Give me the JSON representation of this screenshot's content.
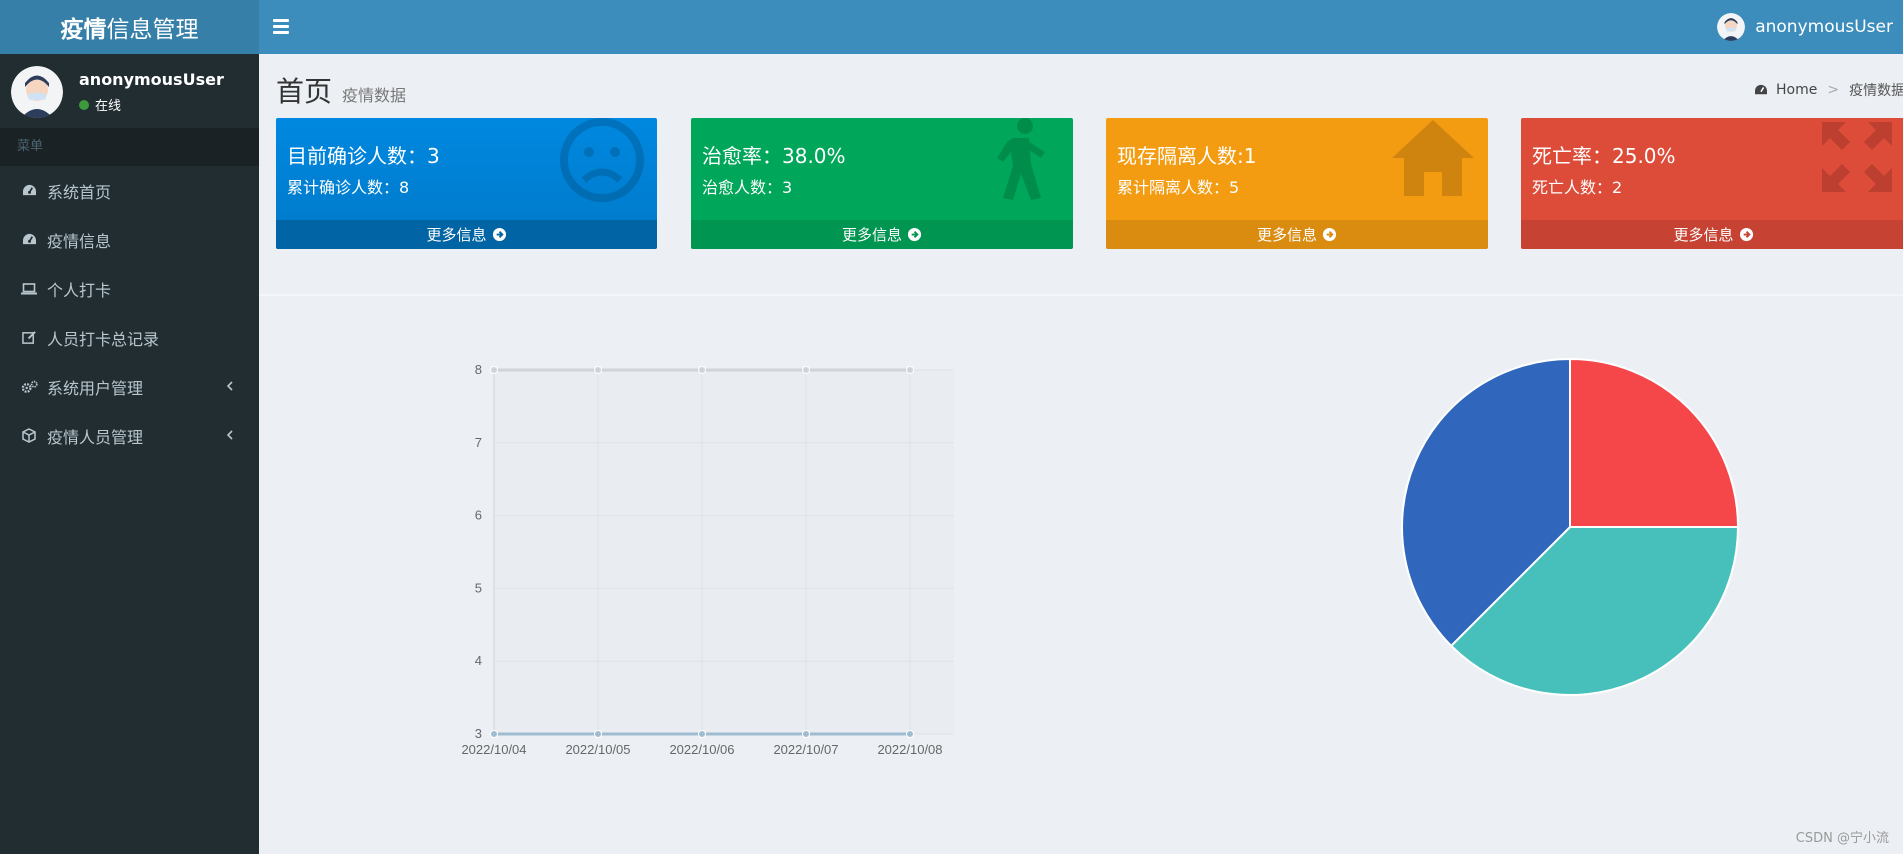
{
  "header": {
    "logo_bold": "疫情",
    "logo_rest": "信息管理",
    "user_name": "anonymousUser"
  },
  "sidebar": {
    "user_name": "anonymousUser",
    "status": "在线",
    "menu_header": "菜单",
    "items": [
      {
        "label": "系统首页",
        "icon": "dashboard-icon",
        "has_children": false
      },
      {
        "label": "疫情信息",
        "icon": "dashboard-icon",
        "has_children": false
      },
      {
        "label": "个人打卡",
        "icon": "laptop-icon",
        "has_children": false
      },
      {
        "label": "人员打卡总记录",
        "icon": "edit-icon",
        "has_children": false
      },
      {
        "label": "系统用户管理",
        "icon": "gears-icon",
        "has_children": true
      },
      {
        "label": "疫情人员管理",
        "icon": "cube-icon",
        "has_children": true
      }
    ]
  },
  "content": {
    "title": "首页",
    "subtitle": "疫情数据",
    "breadcrumb": {
      "home": "Home",
      "current": "疫情数据"
    }
  },
  "stats": [
    {
      "line1": "目前确诊人数：3",
      "line2": "累计确诊人数：8",
      "more": "更多信息",
      "icon": "frown-icon",
      "color": "#0088e0"
    },
    {
      "line1": "治愈率：38.0%",
      "line2": "治愈人数：3",
      "more": "更多信息",
      "icon": "walking-icon",
      "color": "#00a65a"
    },
    {
      "line1": "现存隔离人数:1",
      "line2": "累计隔离人数：5",
      "more": "更多信息",
      "icon": "home-icon",
      "color": "#f39c12"
    },
    {
      "line1": "死亡率：25.0%",
      "line2": "死亡人数：2",
      "more": "更多信息",
      "icon": "expand-icon",
      "color": "#dd4b39"
    }
  ],
  "chart_data": [
    {
      "type": "line",
      "x": [
        "2022/10/04",
        "2022/10/05",
        "2022/10/06",
        "2022/10/07",
        "2022/10/08"
      ],
      "series": [
        {
          "values": [
            8,
            8,
            8,
            8,
            8
          ],
          "color": "#d0d4d8"
        },
        {
          "values": [
            3,
            3,
            3,
            3,
            3
          ],
          "color": "#9fbcd0"
        }
      ],
      "ylim": [
        3,
        8
      ],
      "yticks": [
        3,
        4,
        5,
        6,
        7,
        8
      ],
      "grid": true
    },
    {
      "type": "pie",
      "slices": [
        {
          "value": 25,
          "color": "#f5474a"
        },
        {
          "value": 37.5,
          "color": "#47c0bb"
        },
        {
          "value": 37.5,
          "color": "#3067bd"
        }
      ]
    }
  ],
  "watermark": "CSDN @宁小流"
}
